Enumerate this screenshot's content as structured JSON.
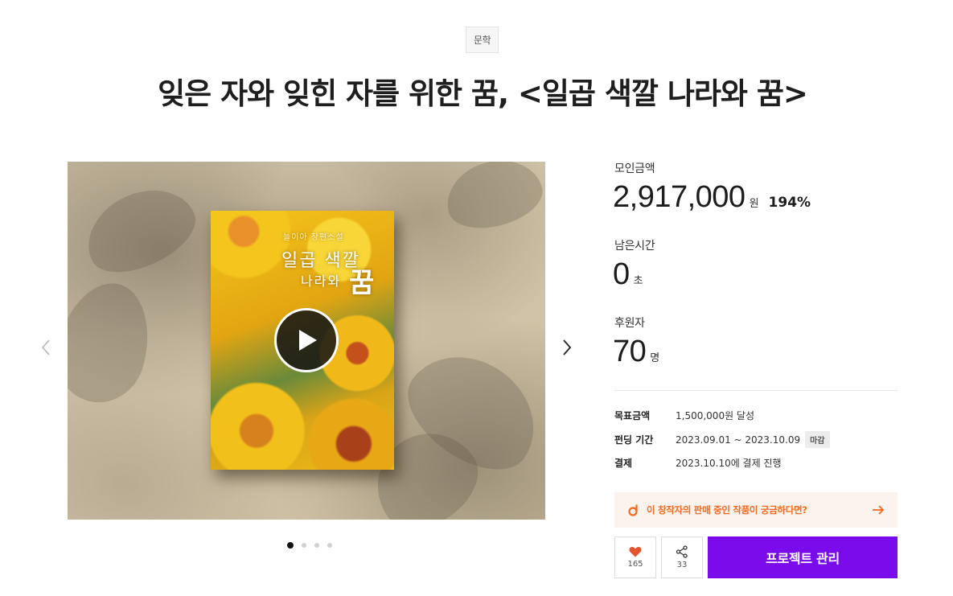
{
  "category": "문학",
  "title": "잊은 자와 잊힌 자를 위한 꿈, <일곱 색깔 나라와 꿈>",
  "media": {
    "cover_author": "늘이아 장편소설",
    "cover_title_line1": "일곱 색깔",
    "cover_title_line2": "나라와",
    "cover_title_line3": "꿈",
    "slide_count": 4,
    "active_slide": 1
  },
  "stats": {
    "raised": {
      "label": "모인금액",
      "value": "2,917,000",
      "unit": "원",
      "percent": "194%"
    },
    "time_left": {
      "label": "남은시간",
      "value": "0",
      "unit": "초"
    },
    "backers": {
      "label": "후원자",
      "value": "70",
      "unit": "명"
    }
  },
  "details": {
    "goal": {
      "label": "목표금액",
      "value": "1,500,000원 달성"
    },
    "period": {
      "label": "펀딩 기간",
      "value": "2023.09.01 ~ 2023.10.09",
      "badge": "마감"
    },
    "payment": {
      "label": "결제",
      "value": "2023.10.10에 결제 진행"
    }
  },
  "promo": {
    "text": "이 창작자의 판매 중인 작품이 궁금하다면?",
    "color": "#f46a1f"
  },
  "actions": {
    "like_count": "165",
    "share_count": "33",
    "manage_label": "프로젝트 관리",
    "accent_color": "#7a0bea"
  }
}
